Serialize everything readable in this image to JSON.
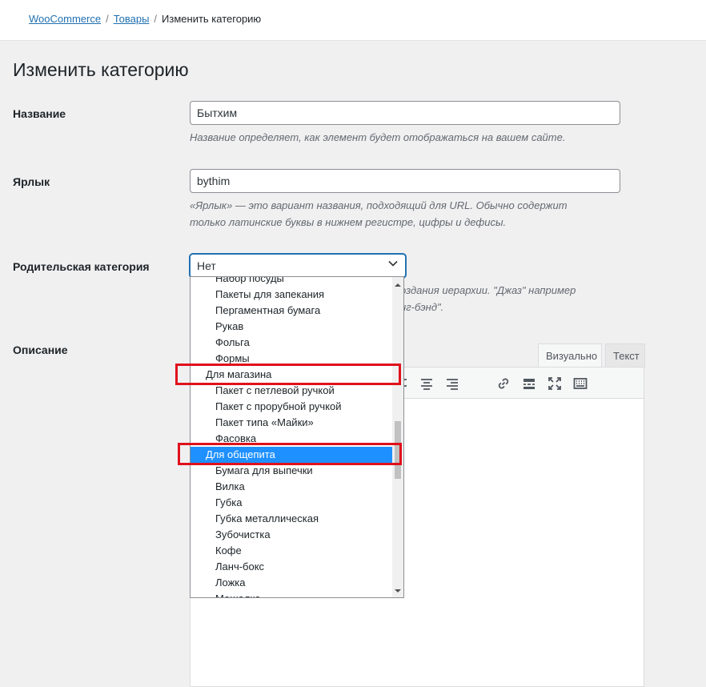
{
  "breadcrumb": {
    "root": "WooCommerce",
    "parent": "Товары",
    "current": "Изменить категорию",
    "separator": "/"
  },
  "page_title": "Изменить категорию",
  "name_field": {
    "label": "Название",
    "value": "Бытхим",
    "description": "Название определяет, как элемент будет отображаться на вашем сайте."
  },
  "slug_field": {
    "label": "Ярлык",
    "value": "bythim",
    "description_line1": "«Ярлык» — это вариант названия, подходящий для URL. Обычно содержит",
    "description_line2": "только латинские буквы в нижнем регистре, цифры и дефисы."
  },
  "parent_field": {
    "label": "Родительская категория",
    "selected": "Нет",
    "description_line1_visible": "оздания иерархии. \"Джаз\" например",
    "description_line2_visible": "иг-бэнд\".",
    "options": [
      {
        "label": "Набор посуды",
        "level": 1
      },
      {
        "label": "Пакеты для запекания",
        "level": 1
      },
      {
        "label": "Пергаментная бумага",
        "level": 1
      },
      {
        "label": "Рукав",
        "level": 1
      },
      {
        "label": "Фольга",
        "level": 1
      },
      {
        "label": "Формы",
        "level": 1
      },
      {
        "label": "Для магазина",
        "level": 0
      },
      {
        "label": "Пакет с петлевой ручкой",
        "level": 1
      },
      {
        "label": "Пакет с прорубной ручкой",
        "level": 1
      },
      {
        "label": "Пакет типа «Майки»",
        "level": 1
      },
      {
        "label": "Фасовка",
        "level": 1
      },
      {
        "label": "Для общепита",
        "level": 0,
        "highlighted": true
      },
      {
        "label": "Бумага для выпечки",
        "level": 1
      },
      {
        "label": "Вилка",
        "level": 1
      },
      {
        "label": "Губка",
        "level": 1
      },
      {
        "label": "Губка металлическая",
        "level": 1
      },
      {
        "label": "Зубочистка",
        "level": 1
      },
      {
        "label": "Кофе",
        "level": 1
      },
      {
        "label": "Ланч-бокс",
        "level": 1
      },
      {
        "label": "Ложка",
        "level": 1
      },
      {
        "label": "Мешалка",
        "level": 1
      }
    ]
  },
  "description_field": {
    "label": "Описание",
    "tab_visual": "Визуально",
    "tab_text": "Текст"
  },
  "colors": {
    "accent": "#2271b1",
    "highlight_option": "#1e90ff",
    "annotation_red": "#e0111c"
  }
}
